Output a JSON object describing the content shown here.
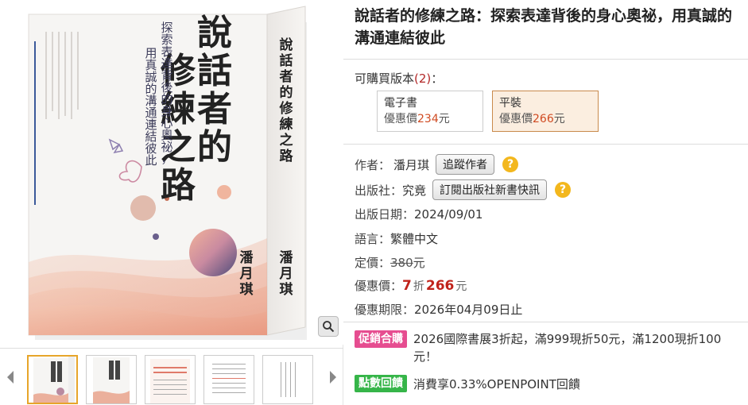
{
  "product": {
    "title": "說話者的修練之路：探索表達背後的身心奧祕，用真誠的溝通連結彼此"
  },
  "cover": {
    "title_chars": [
      "說",
      "話",
      "者",
      "的",
      "修",
      "練",
      "之",
      "路"
    ],
    "subtitle_line1": "探索表達背後的身心奧祕，",
    "subtitle_line2": "用真誠的溝通連結彼此",
    "author": "潘月琪",
    "spine_title": "說話者的修練之路",
    "publisher_mark": "究竟"
  },
  "editions": {
    "label": "可購買版本",
    "count": "(2)",
    "colon": "：",
    "items": [
      {
        "name": "電子書",
        "price_label": "優惠價",
        "price": "234",
        "unit": "元"
      },
      {
        "name": "平裝",
        "price_label": "優惠價",
        "price": "266",
        "unit": "元"
      }
    ]
  },
  "details": {
    "author_label": "作者：",
    "author": "潘月琪",
    "follow_author": "追蹤作者",
    "publisher_label": "出版社：",
    "publisher": "究竟",
    "subscribe_publisher": "訂閱出版社新書快訊",
    "help_glyph": "?",
    "date_label": "出版日期：",
    "date": "2024/09/01",
    "language_label": "語言：",
    "language": "繁體中文",
    "list_price_label": "定價：",
    "list_price": "380",
    "list_price_unit": "元",
    "sale_label": "優惠價：",
    "discount": "7",
    "discount_unit": "折",
    "sale_price": "266",
    "sale_unit": "元",
    "period_label": "優惠期限：",
    "period": "2026年04月09日止"
  },
  "promotions": [
    {
      "badge": "促銷合購",
      "text": "2026國際書展3折起，滿999現折50元，滿1200現折100元！",
      "color": "#e64d90"
    },
    {
      "badge": "點數回饋",
      "text": "消費享0.33%OPENPOINT回饋",
      "color": "#36b549"
    }
  ],
  "icons": {
    "zoom": "magnifier-icon",
    "prev": "chevron-left-icon",
    "next": "chevron-right-icon"
  },
  "colors": {
    "accent": "#c0231b",
    "selected_bg": "#fbeee0",
    "help": "#f3b71d"
  }
}
